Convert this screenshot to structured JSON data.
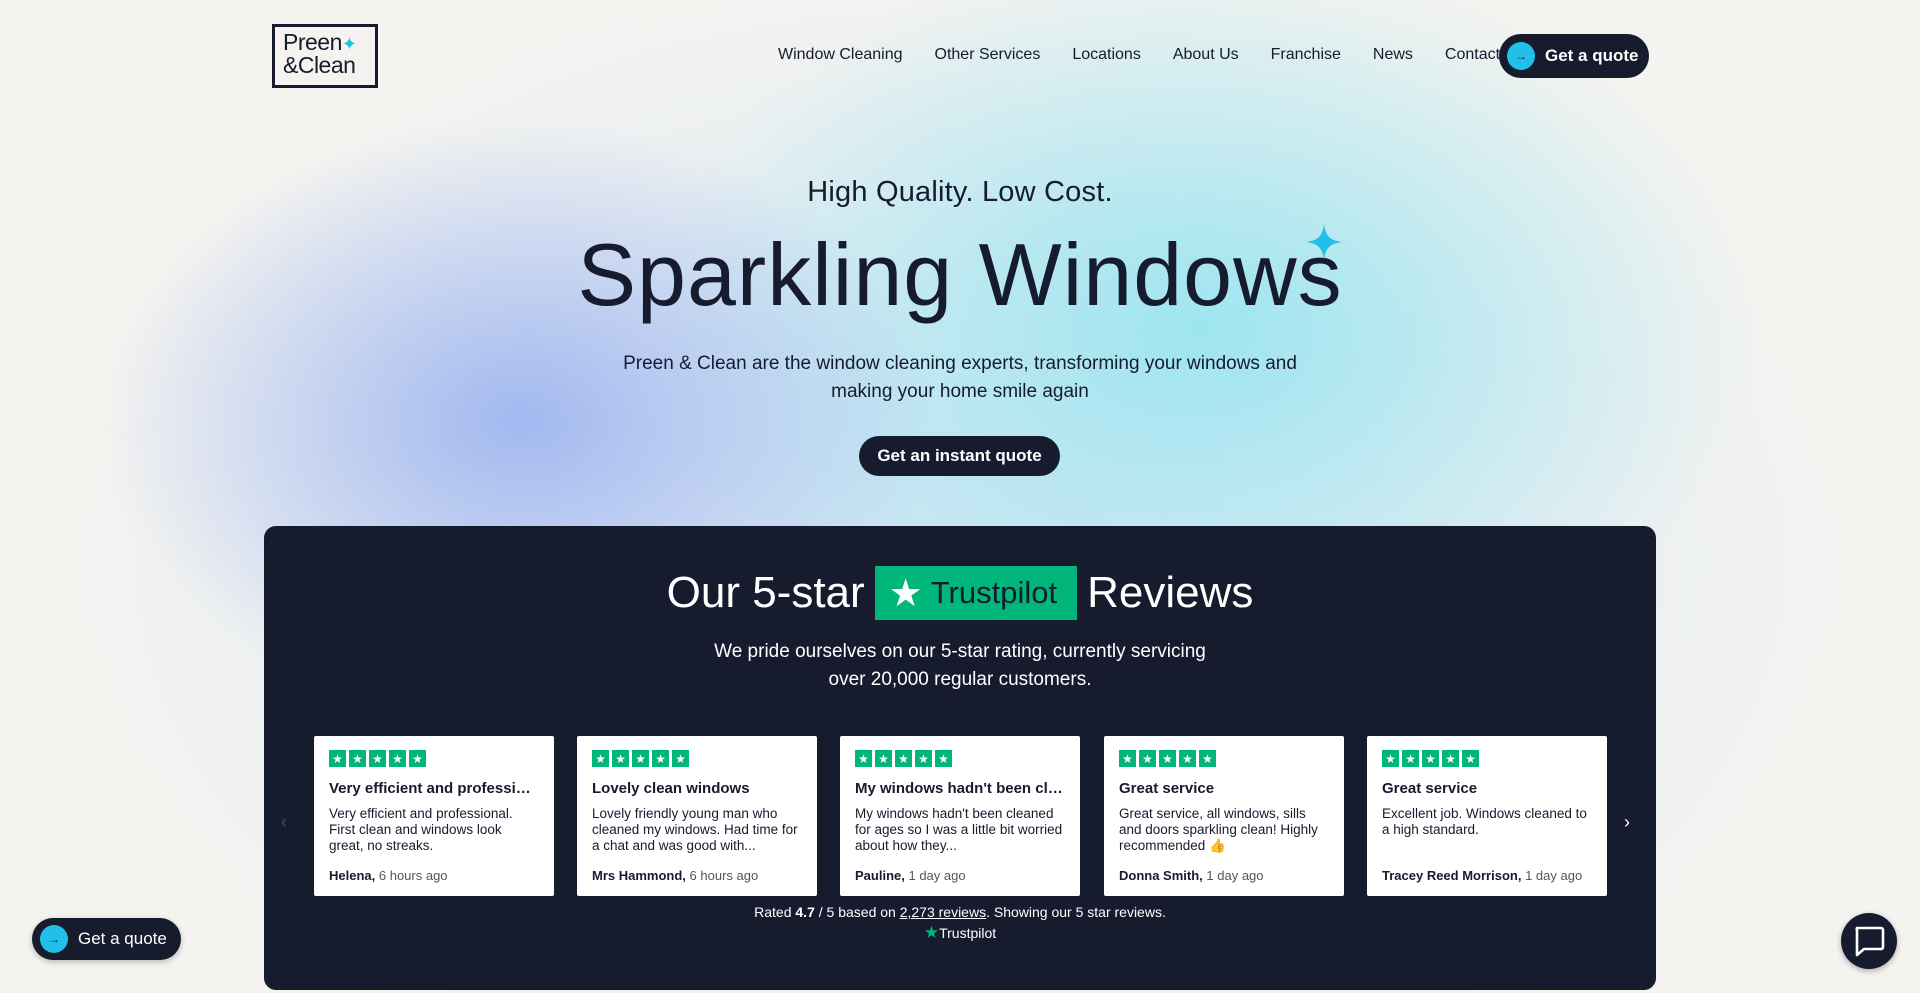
{
  "logo": {
    "line1": "Preen",
    "line2": "&Clean"
  },
  "nav": {
    "items": [
      "Window Cleaning",
      "Other Services",
      "Locations",
      "About Us",
      "Franchise",
      "News",
      "Contact"
    ],
    "quote_label": "Get a quote"
  },
  "hero": {
    "kicker": "High Quality. Low Cost.",
    "title": "Sparkling Windows",
    "subtitle": "Preen & Clean are the window cleaning experts, transforming your windows and making your home smile again",
    "cta": "Get an instant quote"
  },
  "reviews": {
    "heading_pre": "Our 5-star",
    "badge": "Trustpilot",
    "heading_post": "Reviews",
    "subtitle": "We pride ourselves on our 5-star rating, currently servicing over 20,000 regular customers.",
    "cards": [
      {
        "title": "Very efficient and professional",
        "body": "Very efficient and professional. First clean and windows look great, no streaks.",
        "author": "Helena,",
        "time": "6 hours ago",
        "stars": 5
      },
      {
        "title": "Lovely clean windows",
        "body": "Lovely friendly young man who cleaned my windows. Had time for a chat and was good with...",
        "author": "Mrs Hammond,",
        "time": "6 hours ago",
        "stars": 5
      },
      {
        "title": "My windows hadn't been cleaned",
        "body": "My windows hadn't been cleaned for ages so I was a little bit worried about how they...",
        "author": "Pauline,",
        "time": "1 day ago",
        "stars": 5
      },
      {
        "title": "Great service",
        "body": "Great service, all windows, sills and doors sparkling clean! Highly recommended 👍",
        "author": "Donna Smith,",
        "time": "1 day ago",
        "stars": 5
      },
      {
        "title": "Great service",
        "body": "Excellent job. Windows cleaned to a high standard.",
        "author": "Tracey Reed Morrison,",
        "time": "1 day ago",
        "stars": 5
      }
    ],
    "rated_pre": "Rated",
    "rating": "4.7",
    "rated_mid": "/ 5 based on",
    "review_count": "2,273 reviews",
    "rated_post": ". Showing our 5 star reviews.",
    "brand": "Trustpilot"
  },
  "floating": {
    "quote_label": "Get a quote"
  },
  "colors": {
    "navy": "#161b2e",
    "cyan": "#22c0e8",
    "trustpilot_green": "#00b67a"
  }
}
